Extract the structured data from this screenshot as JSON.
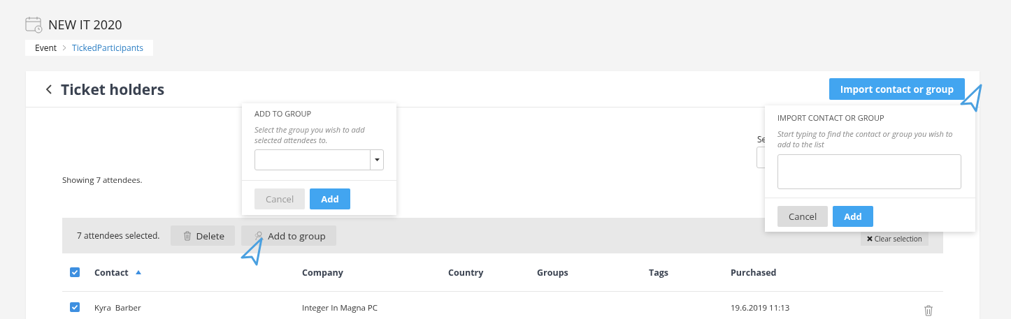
{
  "event": {
    "title": "NEW IT 2020"
  },
  "breadcrumb": [
    {
      "label": "Event",
      "selected": false
    },
    {
      "label": "TickedParticipants",
      "selected": true
    }
  ],
  "card": {
    "title": "Ticket holders",
    "import_button": "Import contact or group"
  },
  "summary": "Showing 7 attendees.",
  "search_label": "Se",
  "selection_bar": {
    "count_text": "7 attendees selected.",
    "buttons": [
      {
        "kind": "delete",
        "label": "Delete"
      },
      {
        "kind": "group",
        "label": "Add to group"
      }
    ],
    "clear_button": "Clear selection"
  },
  "table": {
    "all_checked": true,
    "columns": [
      {
        "label": "Contact",
        "sorted": true
      },
      {
        "label": "Company",
        "sorted": false
      },
      {
        "label": "Country",
        "sorted": false
      },
      {
        "label": "Groups",
        "sorted": false
      },
      {
        "label": "Tags",
        "sorted": false
      },
      {
        "label": "Purchased",
        "sorted": false
      }
    ],
    "rows": [
      {
        "checked": true,
        "contact": "Kyra  Barber",
        "company": "Integer In Magna PC",
        "purchased": "19.6.2019 11:13"
      }
    ]
  },
  "add_to_group_popover": {
    "title": "ADD TO GROUP",
    "hint": "Select the group you wish to add selected attendees to.",
    "cancel": "Cancel",
    "add": "Add"
  },
  "import_popover": {
    "title": "IMPORT CONTACT OR GROUP",
    "hint": "Start typing to find the contact or group you wish to add to the list",
    "cancel": "Cancel",
    "add": "Add"
  }
}
